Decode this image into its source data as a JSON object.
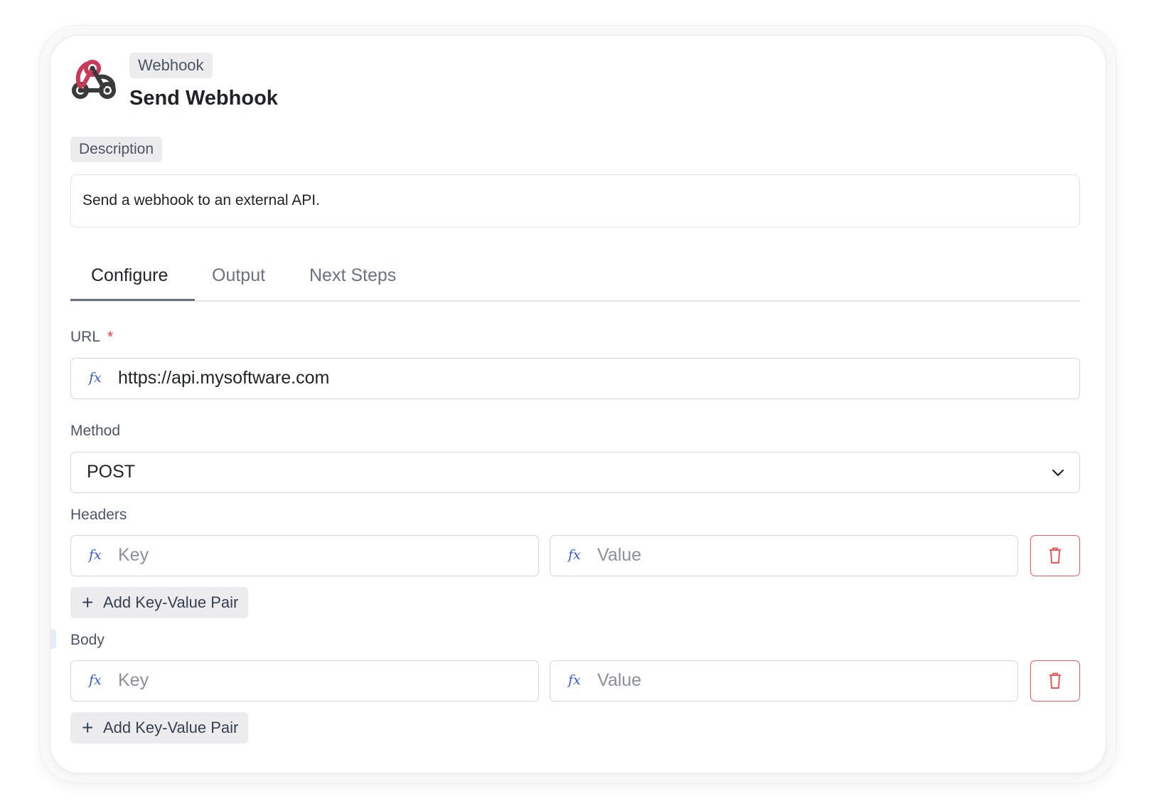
{
  "header": {
    "badge": "Webhook",
    "title": "Send Webhook"
  },
  "description": {
    "label": "Description",
    "value": "Send a webhook to an external API."
  },
  "tabs": [
    {
      "label": "Configure",
      "active": true
    },
    {
      "label": "Output",
      "active": false
    },
    {
      "label": "Next Steps",
      "active": false
    }
  ],
  "url": {
    "label": "URL",
    "required_mark": "*",
    "fx": "fx",
    "value": "https://api.mysoftware.com"
  },
  "method": {
    "label": "Method",
    "value": "POST"
  },
  "headers": {
    "label": "Headers",
    "key_placeholder": "Key",
    "value_placeholder": "Value",
    "fx": "fx",
    "add_label": "Add Key-Value Pair"
  },
  "body": {
    "label": "Body",
    "key_placeholder": "Key",
    "value_placeholder": "Value",
    "fx": "fx",
    "add_label": "Add Key-Value Pair"
  },
  "colors": {
    "webhook_red": "#c73b5a",
    "webhook_dark": "#3a3a3c",
    "fx_blue": "#3b5bc5",
    "delete_red": "#e55a5a",
    "required_red": "#e53935"
  },
  "icons": {
    "logo": "webhook-icon",
    "fx": "fx-icon",
    "dropdown": "chevron-down-icon",
    "delete": "trash-icon",
    "add": "plus-icon"
  }
}
